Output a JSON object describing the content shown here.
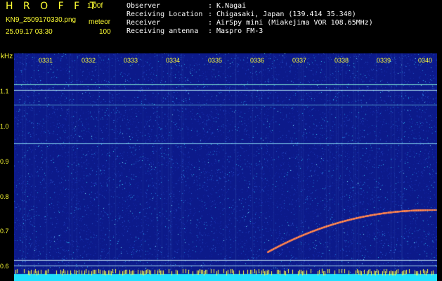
{
  "header": {
    "app_title": "H R O F F T",
    "version": "1.00f",
    "filename": "KN9_2509170330.png",
    "mode": "meteor",
    "datetime": "25.09.17 03:30",
    "level": "100",
    "info": [
      {
        "key": "Observer",
        "value": ": K.Nagai"
      },
      {
        "key": "Receiving Location",
        "value": ": Chigasaki, Japan (139.414 35.340)"
      },
      {
        "key": "Receiver",
        "value": ": AirSpy mini (Miakejima VOR 108.65MHz)"
      },
      {
        "key": "Receiving antenna",
        "value": ": Maspro FM-3"
      }
    ]
  },
  "axis": {
    "y_unit": "kHz",
    "y_ticks": [
      "1.1",
      "1.0",
      "0.9",
      "0.8",
      "0.7",
      "0.6"
    ],
    "time_ticks": [
      "0331",
      "0332",
      "0333",
      "0334",
      "0335",
      "0336",
      "0337",
      "0338",
      "0339",
      "0340"
    ]
  },
  "colors": {
    "background": "#000000",
    "label": "#ffff33",
    "info_text": "#ffffff",
    "field": "#1a2a9a",
    "noise_hi": "#00e0ff",
    "trail": "#ff3030"
  }
}
